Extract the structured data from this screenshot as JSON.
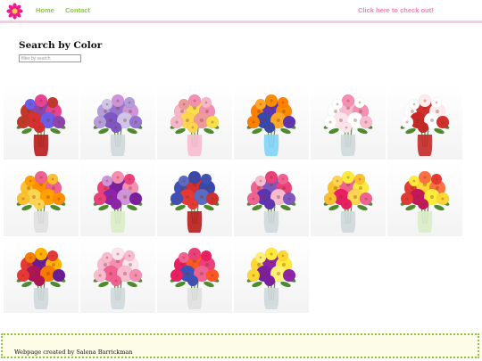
{
  "nav": {
    "home_label": "Home",
    "contact_label": "Contact",
    "checkout_label": "Click here to check out!"
  },
  "main": {
    "title": "Search by Color",
    "search_placeholder": "filter by search"
  },
  "gallery": {
    "items": [
      {
        "flowers": [
          "#c0392b",
          "#8e44ad",
          "#e84393",
          "#d63031",
          "#6c5ce7"
        ],
        "vase": "#b71c1c"
      },
      {
        "flowers": [
          "#b39ddb",
          "#9575cd",
          "#ce93d8",
          "#7e57c2",
          "#d1c4e9"
        ],
        "vase": "#cfd8dc"
      },
      {
        "flowers": [
          "#f5b7c8",
          "#f9e04b",
          "#f48fb1",
          "#ffd54f",
          "#ef9a9a"
        ],
        "vase": "#f8bbd0"
      },
      {
        "flowers": [
          "#ff7f00",
          "#5e35b1",
          "#fb8c00",
          "#3949ab",
          "#ffa726"
        ],
        "vase": "#81d4fa"
      },
      {
        "flowers": [
          "#ffffff",
          "#f8bbd0",
          "#f48fb1",
          "#fce4ec",
          "#ffffff"
        ],
        "vase": "#cfd8dc"
      },
      {
        "flowers": [
          "#ffffff",
          "#d32f2f",
          "#ffebee",
          "#c62828",
          "#ffffff"
        ],
        "vase": "#c62828"
      },
      {
        "flowers": [
          "#fbc02d",
          "#ff8f00",
          "#f06292",
          "#ffd54f",
          "#ffa000"
        ],
        "vase": "#e0e0e0"
      },
      {
        "flowers": [
          "#ec407a",
          "#7b1fa2",
          "#f48fb1",
          "#8e24aa",
          "#ce93d8"
        ],
        "vase": "#dcedc8"
      },
      {
        "flowers": [
          "#3f51b5",
          "#d32f2f",
          "#3949ab",
          "#e53935",
          "#5c6bc0"
        ],
        "vase": "#b71c1c"
      },
      {
        "flowers": [
          "#f06292",
          "#7e57c2",
          "#ec407a",
          "#5e35b1",
          "#f8bbd0"
        ],
        "vase": "#cfd8dc"
      },
      {
        "flowers": [
          "#fbc02d",
          "#f06292",
          "#ffeb3b",
          "#e91e63",
          "#ffd54f"
        ],
        "vase": "#cfd8dc"
      },
      {
        "flowers": [
          "#e53935",
          "#fdd835",
          "#ff7043",
          "#c2185b",
          "#ffeb3b"
        ],
        "vase": "#dcedc8"
      },
      {
        "flowers": [
          "#e53935",
          "#6a1b9a",
          "#ffb300",
          "#ad1457",
          "#f57c00"
        ],
        "vase": "#cfd8dc"
      },
      {
        "flowers": [
          "#f8bbd0",
          "#f48fb1",
          "#fce4ec",
          "#f06292",
          "#f8bbd0"
        ],
        "vase": "#cfd8dc"
      },
      {
        "flowers": [
          "#e91e63",
          "#ff5722",
          "#ec407a",
          "#3f51b5",
          "#f06292"
        ],
        "vase": "#e0e0e0"
      },
      {
        "flowers": [
          "#fdd835",
          "#8e24aa",
          "#ffeb3b",
          "#7b1fa2",
          "#fff176"
        ],
        "vase": "#cfd8dc"
      }
    ]
  },
  "footer": {
    "credit": "Webpage created by Salena Barrickman"
  }
}
